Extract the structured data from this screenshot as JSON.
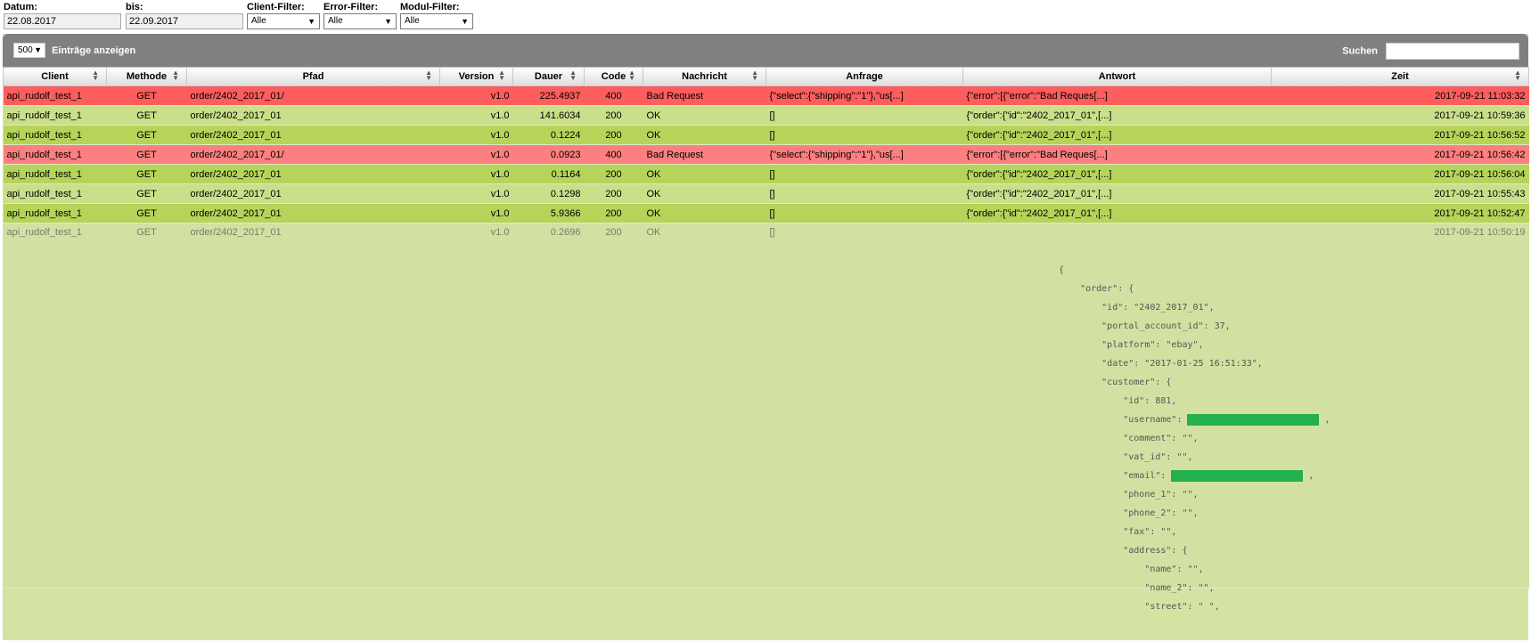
{
  "filters": {
    "date_from_label": "Datum:",
    "date_from_value": "22.08.2017",
    "date_to_label": "bis:",
    "date_to_value": "22.09.2017",
    "client_filter_label": "Client-Filter:",
    "client_filter_value": "Alle",
    "error_filter_label": "Error-Filter:",
    "error_filter_value": "Alle",
    "module_filter_label": "Modul-Filter:",
    "module_filter_value": "Alle"
  },
  "toolbar": {
    "length_value": "500",
    "length_label": "Einträge anzeigen",
    "search_label": "Suchen"
  },
  "columns": [
    "Client",
    "Methode",
    "Pfad",
    "Version",
    "Dauer",
    "Code",
    "Nachricht",
    "Anfrage",
    "Antwort",
    "Zeit"
  ],
  "rows": [
    [
      "api_rudolf_test_1",
      "GET",
      "order/2402_2017_01/",
      "v1.0",
      "225.4937",
      "400",
      "Bad Request",
      "{\"select\":{\"shipping\":\"1\"},\"us[...]",
      "{\"error\":[{\"error\":\"Bad Reques[...]",
      "2017-09-21 11:03:32"
    ],
    [
      "api_rudolf_test_1",
      "GET",
      "order/2402_2017_01",
      "v1.0",
      "141.6034",
      "200",
      "OK",
      "[]",
      "{\"order\":{\"id\":\"2402_2017_01\",[...]",
      "2017-09-21 10:59:36"
    ],
    [
      "api_rudolf_test_1",
      "GET",
      "order/2402_2017_01",
      "v1.0",
      "0.1224",
      "200",
      "OK",
      "[]",
      "{\"order\":{\"id\":\"2402_2017_01\",[...]",
      "2017-09-21 10:56:52"
    ],
    [
      "api_rudolf_test_1",
      "GET",
      "order/2402_2017_01/",
      "v1.0",
      "0.0923",
      "400",
      "Bad Request",
      "{\"select\":{\"shipping\":\"1\"},\"us[...]",
      "{\"error\":[{\"error\":\"Bad Reques[...]",
      "2017-09-21 10:56:42"
    ],
    [
      "api_rudolf_test_1",
      "GET",
      "order/2402_2017_01",
      "v1.0",
      "0.1164",
      "200",
      "OK",
      "[]",
      "{\"order\":{\"id\":\"2402_2017_01\",[...]",
      "2017-09-21 10:56:04"
    ],
    [
      "api_rudolf_test_1",
      "GET",
      "order/2402_2017_01",
      "v1.0",
      "0.1298",
      "200",
      "OK",
      "[]",
      "{\"order\":{\"id\":\"2402_2017_01\",[...]",
      "2017-09-21 10:55:43"
    ],
    [
      "api_rudolf_test_1",
      "GET",
      "order/2402_2017_01",
      "v1.0",
      "5.9366",
      "200",
      "OK",
      "[]",
      "{\"order\":{\"id\":\"2402_2017_01\",[...]",
      "2017-09-21 10:52:47"
    ],
    [
      "api_rudolf_test_1",
      "GET",
      "order/2402_2017_01",
      "v1.0",
      "0.2696",
      "200",
      "OK",
      "[]",
      "",
      "2017-09-21 10:50:19"
    ]
  ],
  "expanded_json": [
    "{",
    "    \"order\": {",
    "        \"id\": \"2402_2017_01\",",
    "        \"portal_account_id\": 37,",
    "        \"platform\": \"ebay\",",
    "        \"date\": \"2017-01-25 16:51:33\",",
    "        \"customer\": {",
    "            \"id\": 881,",
    "            \"username\":",
    "            \"comment\": \"\",",
    "            \"vat_id\": \"\",",
    "            \"email\":",
    "            \"phone_1\": \"\",",
    "            \"phone_2\": \"\",",
    "            \"fax\": \"\",",
    "            \"address\": {",
    "                \"name\": \"\",",
    "                \"name_2\": \"\",",
    "                \"street\": \" \","
  ],
  "redacted_suffix": ","
}
